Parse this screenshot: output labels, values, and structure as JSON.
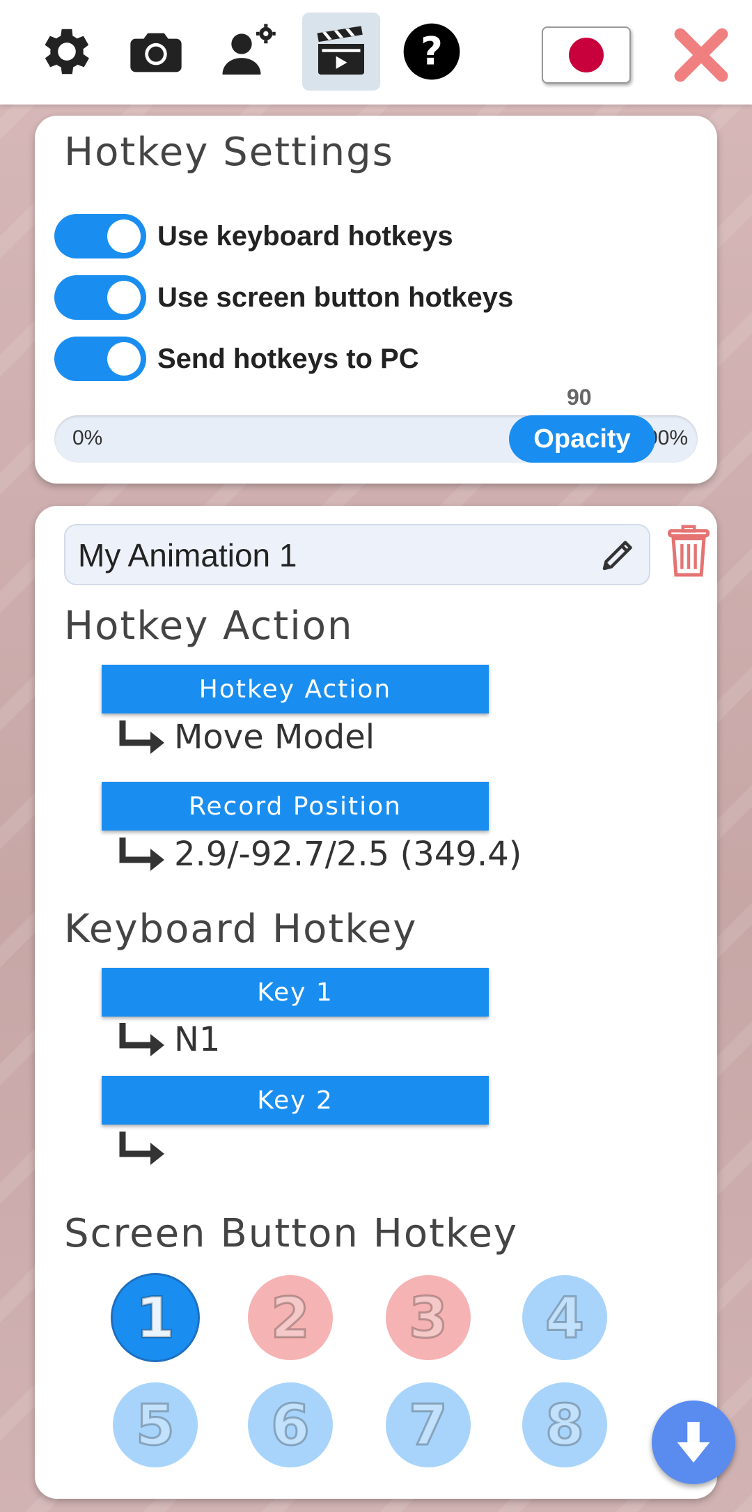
{
  "toolbar": {
    "icons": [
      "gear-icon",
      "camera-icon",
      "user-settings-icon",
      "clapperboard-icon",
      "help-icon"
    ],
    "active_icon": "clapperboard-icon",
    "language_flag": "japan-flag",
    "close_color": "#f08080"
  },
  "hotkey_settings": {
    "title": "Hotkey Settings",
    "toggles": [
      {
        "label": "Use keyboard hotkeys",
        "on": true
      },
      {
        "label": "Use screen button hotkeys",
        "on": true
      },
      {
        "label": "Send hotkeys to PC",
        "on": true
      }
    ],
    "opacity": {
      "value": "90",
      "thumb_label": "Opacity",
      "min_label": "0%",
      "max_label": "100%",
      "fraction": 0.9
    }
  },
  "animation": {
    "name": "My Animation 1",
    "hotkey_action_title": "Hotkey Action",
    "action_button": "Hotkey Action",
    "action_value": "Move Model",
    "record_button": "Record Position",
    "record_value": "2.9/-92.7/2.5 (349.4)",
    "keyboard_title": "Keyboard Hotkey",
    "key1_button": "Key 1",
    "key1_value": "N1",
    "key2_button": "Key 2",
    "key2_value": "",
    "screen_title": "Screen Button Hotkey",
    "screen_buttons": [
      "1",
      "2",
      "3",
      "4",
      "5",
      "6",
      "7",
      "8"
    ],
    "selected_screen_button": "1"
  },
  "colors": {
    "accent": "#1a8ef0",
    "pink_button": "#f6b3b3",
    "light_blue_button": "#a8d4fb",
    "delete": "#e57373",
    "fab": "#5a8cf0"
  }
}
